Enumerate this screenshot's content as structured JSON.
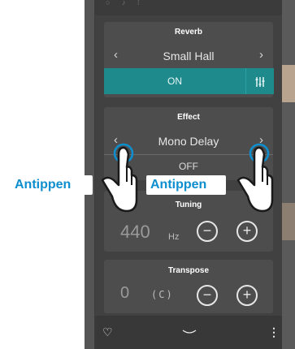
{
  "reverb": {
    "title": "Reverb",
    "value": "Small Hall",
    "toggle": "ON",
    "prev_icon": "chevron-left-icon",
    "next_icon": "chevron-right-icon",
    "settings_icon": "sliders-icon"
  },
  "effect": {
    "title": "Effect",
    "value": "Mono Delay",
    "toggle": "OFF",
    "prev_icon": "chevron-left-icon",
    "next_icon": "chevron-right-icon"
  },
  "tuning": {
    "title": "Tuning",
    "value": "440",
    "unit": "Hz",
    "minus_icon": "minus-circle-icon",
    "plus_icon": "plus-circle-icon"
  },
  "transpose": {
    "title": "Transpose",
    "value": "0",
    "unit": "(C)",
    "minus_icon": "minus-circle-icon",
    "plus_icon": "plus-circle-icon"
  },
  "bottom_bar": {
    "favorite_icon": "heart-icon",
    "collapse_icon": "chevron-down-icon",
    "menu_icon": "more-vertical-icon"
  },
  "annotations": {
    "left": "Antippen",
    "right": "Antippen"
  },
  "colors": {
    "accent": "#1e8a8c",
    "annotation": "#0d8fcf",
    "panel": "#414141",
    "card": "#4d4d4d"
  }
}
